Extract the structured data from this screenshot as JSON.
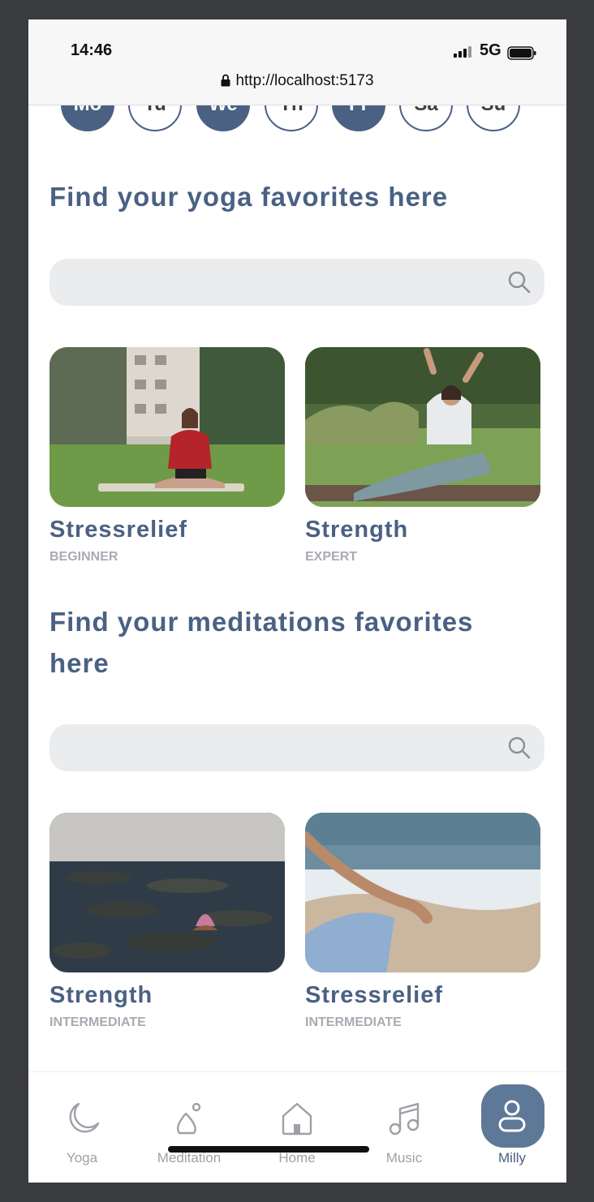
{
  "status_bar": {
    "time": "14:46",
    "network": "5G"
  },
  "browser": {
    "url": "http://localhost:5173"
  },
  "days": [
    {
      "label": "Mo",
      "active": true
    },
    {
      "label": "Tu",
      "active": false
    },
    {
      "label": "We",
      "active": true
    },
    {
      "label": "Th",
      "active": false
    },
    {
      "label": "Fr",
      "active": true
    },
    {
      "label": "Sa",
      "active": false
    },
    {
      "label": "Su",
      "active": false
    }
  ],
  "yoga": {
    "heading": "Find your yoga favorites here",
    "cards": [
      {
        "title": "Stressrelief",
        "level": "BEGINNER"
      },
      {
        "title": "Strength",
        "level": "EXPERT"
      }
    ]
  },
  "meditation": {
    "heading_line1": "Find your meditations favorites",
    "heading_line2": "here",
    "cards": [
      {
        "title": "Strength",
        "level": "INTERMEDIATE"
      },
      {
        "title": "Stressrelief",
        "level": "INTERMEDIATE"
      }
    ]
  },
  "nav": {
    "items": [
      {
        "label": "Yoga",
        "icon": "moon-icon"
      },
      {
        "label": "Meditation",
        "icon": "meditation-icon"
      },
      {
        "label": "Home",
        "icon": "home-icon"
      },
      {
        "label": "Music",
        "icon": "music-note-icon"
      },
      {
        "label": "Milly",
        "icon": "user-icon",
        "active": true
      }
    ]
  },
  "colors": {
    "accent": "#4a6183",
    "active_nav": "#5e7898",
    "search_bg": "#ebecee",
    "muted": "#a8abb2"
  }
}
